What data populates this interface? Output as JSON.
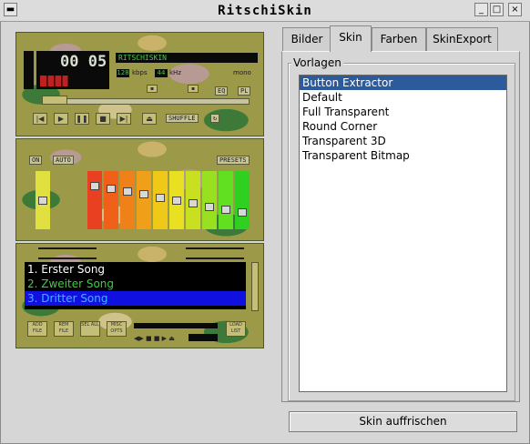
{
  "window": {
    "title": "RitschiSkin",
    "buttons": [
      "_",
      "□",
      "×"
    ]
  },
  "player": {
    "time": "00 05",
    "track_title": "RITSCHISKIN",
    "kbps": "128",
    "kbps_label": "kbps",
    "khz": "44",
    "khz_label": "kHz",
    "mode": "mono",
    "eq_label": "EQ",
    "pl_label": "PL",
    "shuffle_label": "SHUFFLE",
    "on_label": "ON",
    "auto_label": "AUTO",
    "presets_label": "PRESETS",
    "playlist": [
      "1. Erster Song",
      "2. Zweiter Song",
      "3. Dritter Song"
    ],
    "playlist_colors": [
      "#ffffff",
      "#3ad13a",
      "#3ab8ff"
    ],
    "selected_song_bg": "#1010e0",
    "pl_buttons": [
      "ADD FILE",
      "REM FILE",
      "SEL ALL",
      "MISC OPTS",
      "LOAD LIST"
    ],
    "preamp_level": 0.5,
    "eq_levels": [
      0.78,
      0.72,
      0.67,
      0.61,
      0.55,
      0.49,
      0.43,
      0.37,
      0.31,
      0.25
    ]
  },
  "tabs": [
    {
      "label": "Bilder",
      "active": false
    },
    {
      "label": "Skin",
      "active": true
    },
    {
      "label": "Farben",
      "active": false
    },
    {
      "label": "SkinExport",
      "active": false
    }
  ],
  "vorlagen": {
    "title": "Vorlagen",
    "items": [
      "Button Extractor",
      "Default",
      "Full Transparent",
      "Round Corner",
      "Transparent 3D",
      "Transparent Bitmap"
    ],
    "selected_index": 0
  },
  "refresh_label": "Skin auffrischen"
}
